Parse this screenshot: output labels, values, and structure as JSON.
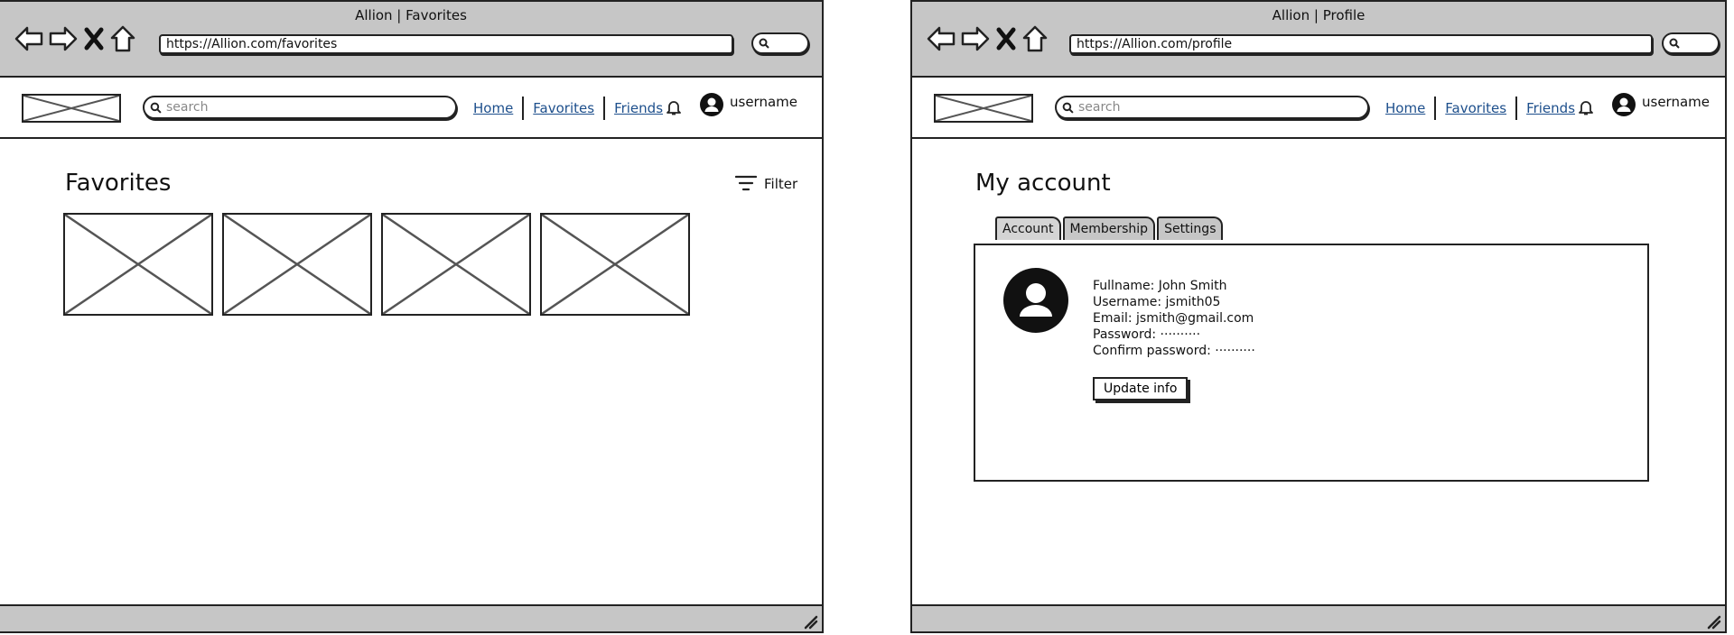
{
  "left": {
    "title": "Allion | Favorites",
    "url": "https://Allion.com/favorites",
    "search_placeholder": "search",
    "nav": [
      "Home",
      "Favorites",
      "Friends"
    ],
    "username": "username",
    "page_title": "Favorites",
    "filter_label": "Filter",
    "thumbnail_count": 4
  },
  "right": {
    "title": "Allion | Profile",
    "url": "https://Allion.com/profile",
    "search_placeholder": "search",
    "nav": [
      "Home",
      "Favorites",
      "Friends"
    ],
    "username": "username",
    "page_title": "My account",
    "tabs": [
      "Account",
      "Membership",
      "Settings"
    ],
    "details": {
      "fullname": "Fullname: John Smith",
      "username": "Username: jsmith05",
      "email": "Email: jsmith@gmail.com",
      "password": "Password: ··········",
      "confirm": "Confirm password: ··········"
    },
    "update_label": "Update info"
  },
  "colors": {
    "chrome": "#c6c6c6",
    "link": "#1d4f8c",
    "border": "#222222"
  }
}
